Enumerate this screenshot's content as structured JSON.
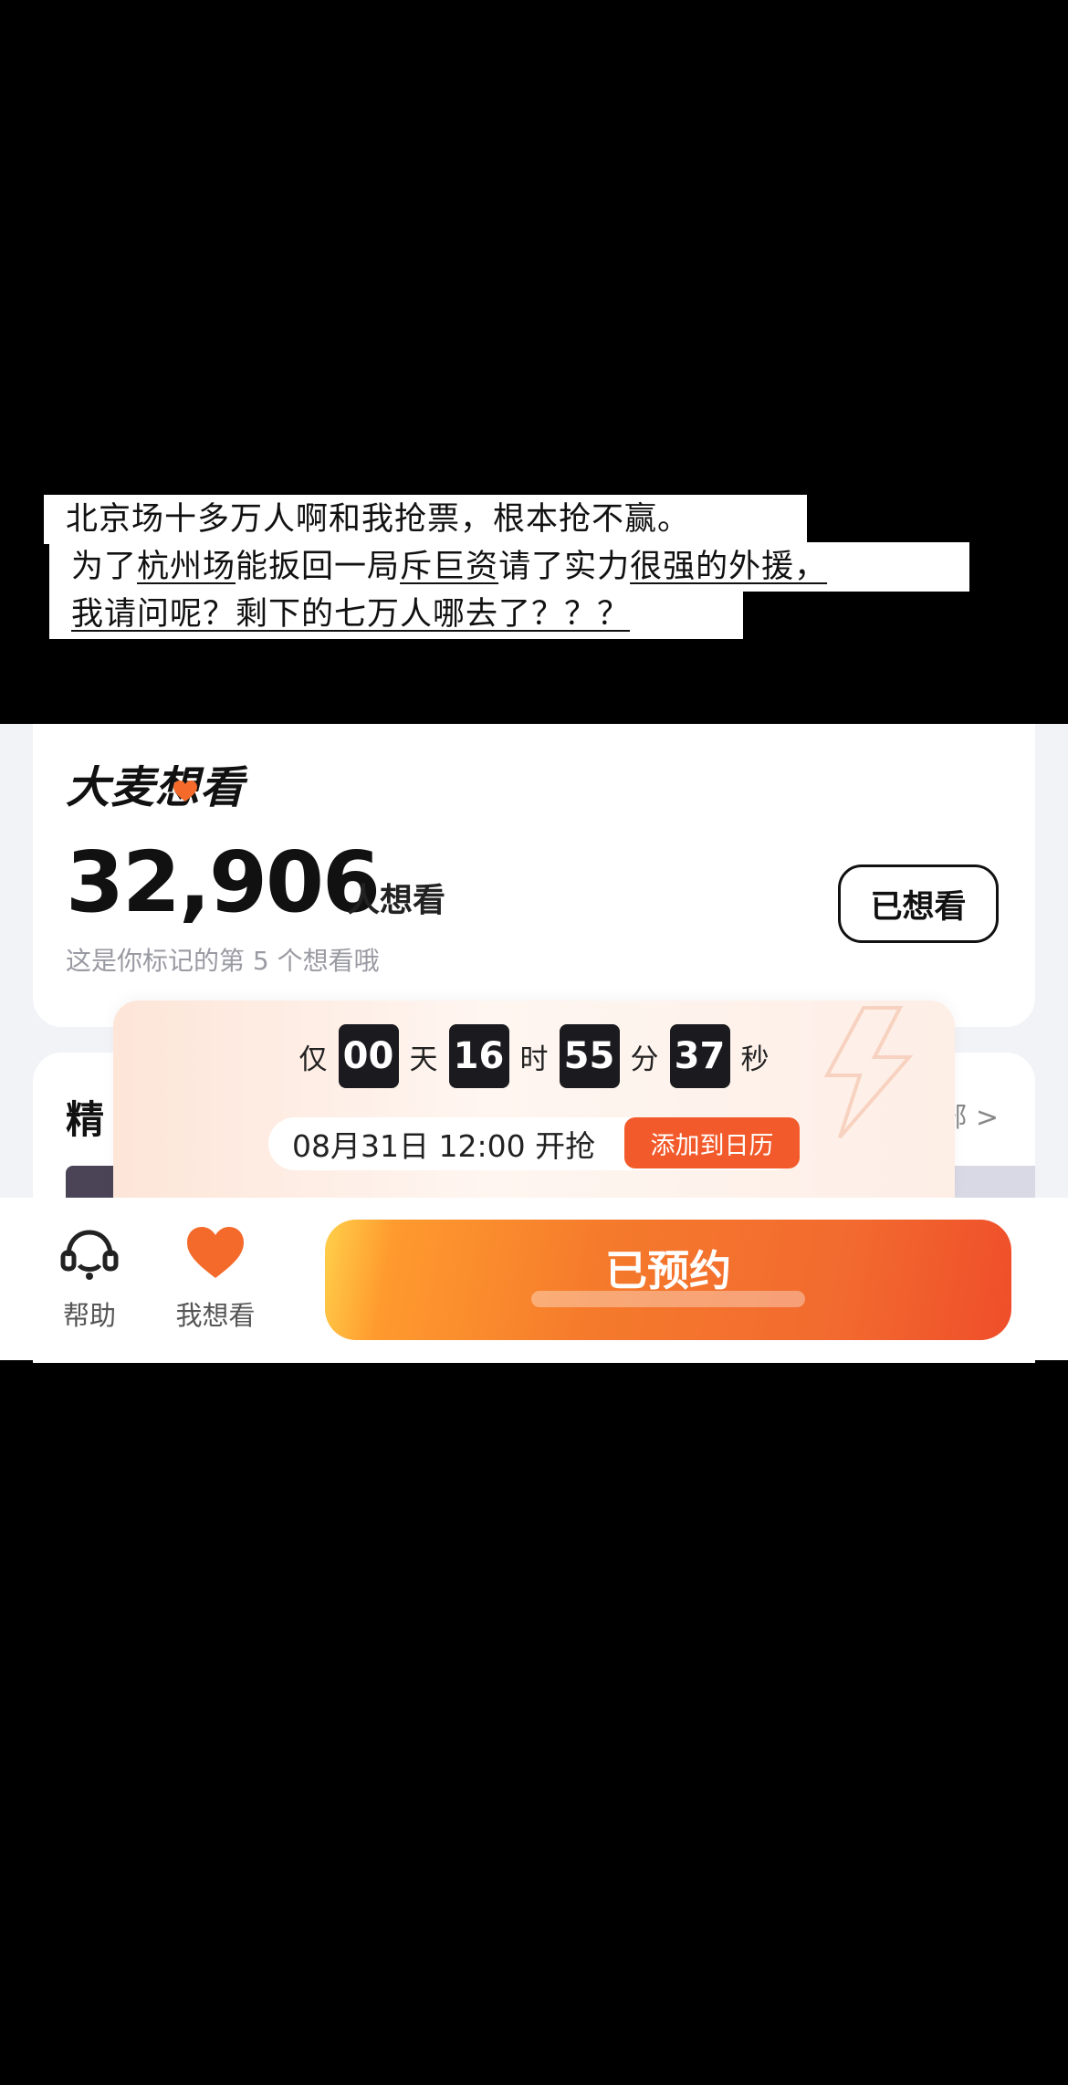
{
  "note": {
    "line1": "北京场十多万人啊和我抢票，根本抢不赢。",
    "line2_a": "为了",
    "line2_b": "杭州场",
    "line2_c": "能扳回一局",
    "line2_d": "斥巨资",
    "line2_e": "请了实力",
    "line2_f": "很强的外援，",
    "line3": "我请问呢？剩下的七万人哪去了？？？"
  },
  "want_card": {
    "brand": "大麦想看",
    "count": "32,906",
    "count_suffix": "人想看",
    "subtitle": "这是你标记的第 5 个想看哦",
    "watched_button": "已想看"
  },
  "section": {
    "title": "精",
    "more": "部 >"
  },
  "countdown": {
    "prefix": "仅",
    "days": "00",
    "days_unit": "天",
    "hours": "16",
    "hours_unit": "时",
    "minutes": "55",
    "minutes_unit": "分",
    "seconds": "37",
    "seconds_unit": "秒",
    "sale_time": "08月31日 12:00 开抢",
    "calendar_button": "添加到日历"
  },
  "bottom_bar": {
    "help_label": "帮助",
    "fav_label": "我想看",
    "reserved_button": "已预约"
  },
  "colors": {
    "accent": "#f25a2b",
    "heart": "#f36a2a",
    "countdown_box": "#1b1b1f"
  },
  "icons": [
    "headset-icon",
    "heart-icon",
    "bolt-icon",
    "chevron-right-icon"
  ]
}
